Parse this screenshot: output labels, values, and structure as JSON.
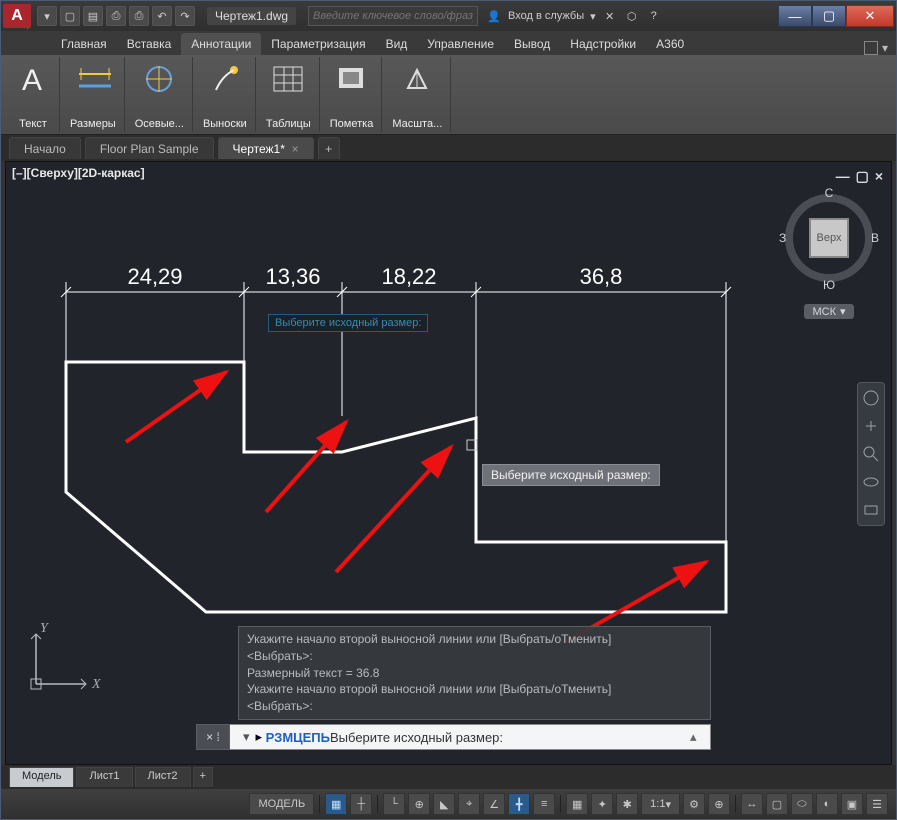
{
  "title_file": "Чертеж1.dwg",
  "search_placeholder": "Введите ключевое слово/фразу",
  "signin_label": "Вход в службы",
  "ribbon_tabs": [
    "Главная",
    "Вставка",
    "Аннотации",
    "Параметризация",
    "Вид",
    "Управление",
    "Вывод",
    "Надстройки",
    "A360"
  ],
  "active_ribbon_tab": 2,
  "ribbon_panels": {
    "text": "Текст",
    "dimensions": "Размеры",
    "centerlines": "Осевые...",
    "leaders": "Выноски",
    "tables": "Таблицы",
    "markup": "Пометка",
    "scale": "Масшта..."
  },
  "file_tabs": [
    "Начало",
    "Floor Plan Sample",
    "Чертеж1*"
  ],
  "active_file_tab": 2,
  "viewport_label": "[–][Сверху][2D-каркас]",
  "viewcube": {
    "face": "Верх",
    "n": "С",
    "s": "Ю",
    "w": "З",
    "e": "В",
    "wcs": "МСК"
  },
  "dimensions": {
    "d1": "24,29",
    "d2": "13,36",
    "d3": "18,22",
    "d4": "36,8"
  },
  "tooltip_small": "Выберите исходный размер:",
  "tooltip_main": "Выберите исходный размер:",
  "ucs": {
    "x": "X",
    "y": "Y"
  },
  "cmd_history": {
    "l1": "Укажите начало второй выносной линии или [Выбрать/оТменить]",
    "l2": "<Выбрать>:",
    "l3": "Размерный текст = 36.8",
    "l4": "Укажите начало второй выносной линии или [Выбрать/оТменить]",
    "l5": "<Выбрать>:"
  },
  "cmd_line": {
    "cmd": "РЗМЦЕПЬ",
    "prompt": " Выберите исходный размер:"
  },
  "layout_tabs": [
    "Модель",
    "Лист1",
    "Лист2"
  ],
  "status": {
    "model": "МОДЕЛЬ",
    "scale": "1:1"
  }
}
